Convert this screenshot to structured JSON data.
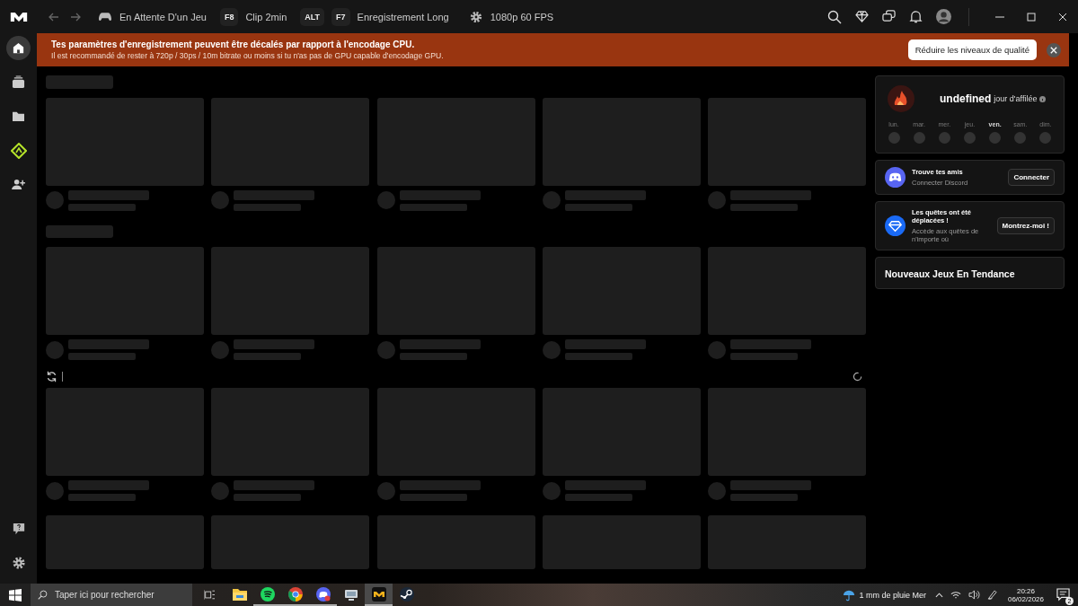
{
  "topbar": {
    "status": "En Attente D'un Jeu",
    "shortcuts": [
      {
        "keys": [
          "F8"
        ],
        "label": "Clip 2min"
      },
      {
        "keys": [
          "ALT",
          "F7"
        ],
        "label": "Enregistrement Long"
      }
    ],
    "quality": "1080p 60 FPS"
  },
  "sidebar": {
    "items": [
      {
        "kind": "home",
        "selected": true
      },
      {
        "kind": "clips",
        "selected": false
      },
      {
        "kind": "folder",
        "selected": false
      },
      {
        "kind": "quests",
        "selected": false
      },
      {
        "kind": "friends",
        "selected": false
      }
    ],
    "bottom": [
      {
        "kind": "help"
      },
      {
        "kind": "settings"
      }
    ]
  },
  "banner": {
    "title": "Tes paramètres d'enregistrement peuvent être décalés par rapport à l'encodage CPU.",
    "message": "Il est recommandé de rester à 720p / 30ps / 10m bitrate ou moins si tu n'as pas de GPU capable d'encodage GPU.",
    "button": "Réduire les niveaux de qualité"
  },
  "feed": {
    "loading": true
  },
  "streak": {
    "count": "undefined",
    "label": "jour d'affilée",
    "days": [
      {
        "label": "lun.",
        "selected": false
      },
      {
        "label": "mar.",
        "selected": false
      },
      {
        "label": "mer.",
        "selected": false
      },
      {
        "label": "jeu.",
        "selected": false
      },
      {
        "label": "ven.",
        "selected": true
      },
      {
        "label": "sam.",
        "selected": false
      },
      {
        "label": "dim.",
        "selected": false
      }
    ]
  },
  "friends_card": {
    "title": "Trouve tes amis",
    "subtitle": "Connecter Discord",
    "button": "Connecter"
  },
  "quests_card": {
    "title": "Les quêtes ont été déplacées !",
    "subtitle": "Accède aux quêtes de n'importe où",
    "button": "Montrez-moi !"
  },
  "trending": {
    "title": "Nouveaux Jeux En Tendance"
  },
  "taskbar": {
    "search_placeholder": "Taper ici pour rechercher",
    "apps": [
      {
        "kind": "files",
        "running": false,
        "active": false
      },
      {
        "kind": "music",
        "running": true,
        "active": false
      },
      {
        "kind": "browser",
        "running": true,
        "active": false
      },
      {
        "kind": "chat",
        "running": true,
        "active": false
      },
      {
        "kind": "network",
        "running": false,
        "active": false
      },
      {
        "kind": "medal",
        "running": true,
        "active": true
      },
      {
        "kind": "steam",
        "running": false,
        "active": false
      }
    ],
    "weather": "1 mm de pluie Mer",
    "time": "20:26",
    "date": "06/02/2026",
    "notifications": "2"
  }
}
